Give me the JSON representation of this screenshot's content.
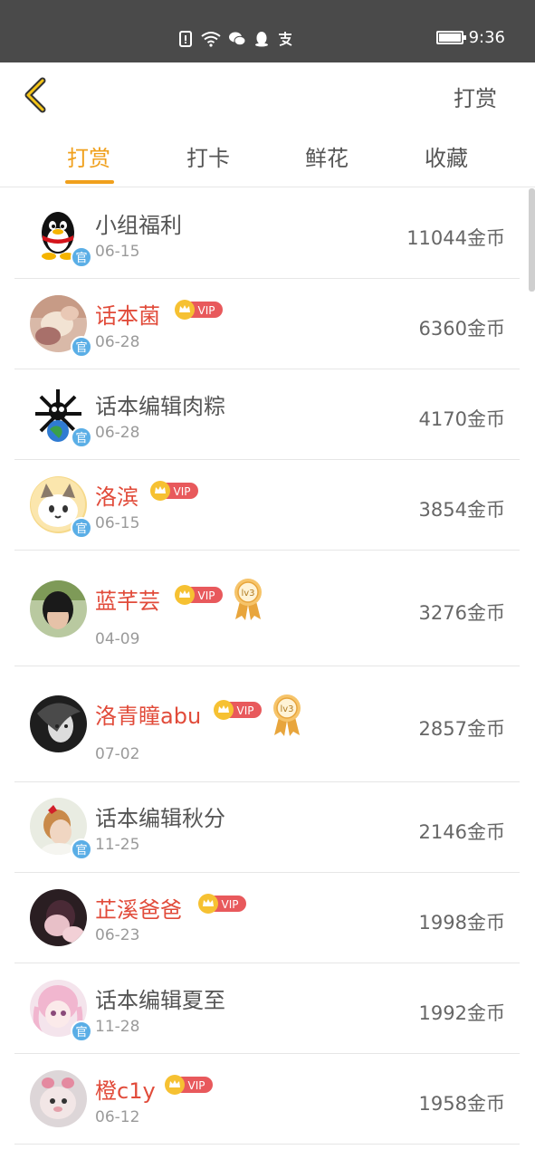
{
  "status_bar": {
    "time": "9:36",
    "icons": [
      "sim-alert-icon",
      "wifi-icon",
      "wechat-icon",
      "qq-icon",
      "alipay-icon"
    ],
    "battery_level": 1.0
  },
  "header": {
    "back_icon": "chevron-left-icon",
    "title": "打赏"
  },
  "tabs": [
    {
      "label": "打赏",
      "active": true
    },
    {
      "label": "打卡",
      "active": false
    },
    {
      "label": "鲜花",
      "active": false
    },
    {
      "label": "收藏",
      "active": false
    }
  ],
  "colors": {
    "accent": "#f0a01c",
    "vip_name": "#e14b3a",
    "official_badge": "#5aaee6",
    "vip_badge": "#e8595c"
  },
  "vip_label": "VIP",
  "official_label": "官",
  "level_label": "lv3",
  "rows": [
    {
      "name": "小组福利",
      "date": "06-15",
      "amount": "11044金币",
      "vip": false,
      "official": true,
      "level": false
    },
    {
      "name": "话本菌",
      "date": "06-28",
      "amount": "6360金币",
      "vip": true,
      "official": true,
      "level": false
    },
    {
      "name": "话本编辑肉粽",
      "date": "06-28",
      "amount": "4170金币",
      "vip": false,
      "official": true,
      "level": false
    },
    {
      "name": "洛滨",
      "date": "06-15",
      "amount": "3854金币",
      "vip": true,
      "official": true,
      "level": false
    },
    {
      "name": "蓝芊芸",
      "date": "04-09",
      "amount": "3276金币",
      "vip": true,
      "official": false,
      "level": true
    },
    {
      "name": "洛青瞳abu",
      "date": "07-02",
      "amount": "2857金币",
      "vip": true,
      "official": false,
      "level": true
    },
    {
      "name": "话本编辑秋分",
      "date": "11-25",
      "amount": "2146金币",
      "vip": false,
      "official": true,
      "level": false
    },
    {
      "name": "芷溪爸爸",
      "date": "06-23",
      "amount": "1998金币",
      "vip": true,
      "official": false,
      "level": false
    },
    {
      "name": "话本编辑夏至",
      "date": "11-28",
      "amount": "1992金币",
      "vip": false,
      "official": true,
      "level": false
    },
    {
      "name": "橙c1y",
      "date": "06-12",
      "amount": "1958金币",
      "vip": true,
      "official": false,
      "level": false
    }
  ]
}
